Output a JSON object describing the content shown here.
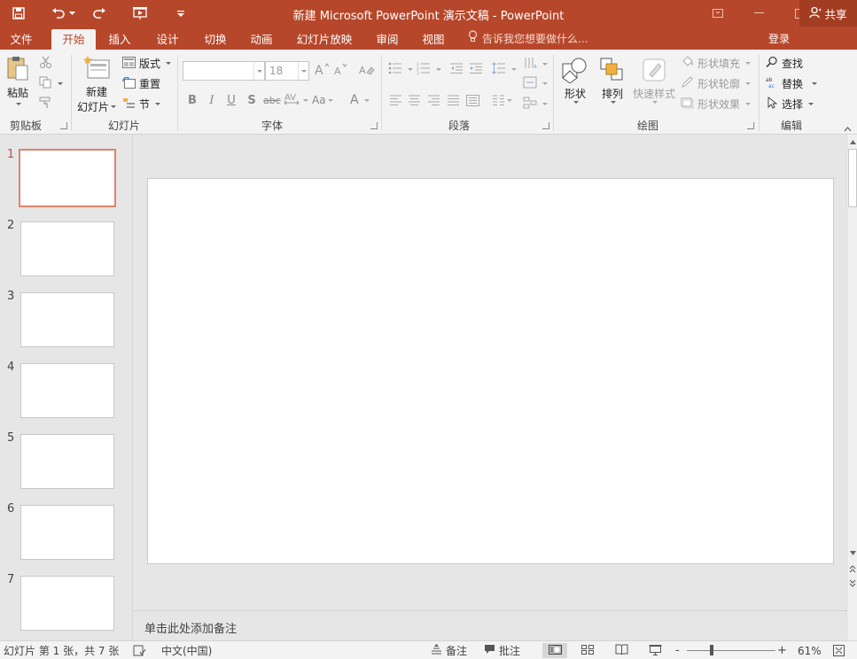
{
  "app": {
    "title": "新建 Microsoft PowerPoint 演示文稿 - PowerPoint",
    "accent": "#b7472a"
  },
  "tabs": [
    {
      "label": "文件"
    },
    {
      "label": "开始"
    },
    {
      "label": "插入"
    },
    {
      "label": "设计"
    },
    {
      "label": "切换"
    },
    {
      "label": "动画"
    },
    {
      "label": "幻灯片放映"
    },
    {
      "label": "审阅"
    },
    {
      "label": "视图"
    }
  ],
  "tellme": "告诉我您想要做什么...",
  "account": {
    "login": "登录",
    "share": "共享"
  },
  "ribbon": {
    "clipboard": {
      "label": "剪贴板",
      "paste": "粘贴"
    },
    "slides": {
      "label": "幻灯片",
      "new_slide_line1": "新建",
      "new_slide_line2": "幻灯片",
      "layout": "版式",
      "reset": "重置",
      "section": "节"
    },
    "font": {
      "label": "字体",
      "font_name": "",
      "font_size": "18"
    },
    "paragraph": {
      "label": "段落"
    },
    "drawing": {
      "label": "绘图",
      "shapes": "形状",
      "arrange": "排列",
      "quick_styles": "快速样式",
      "shape_fill": "形状填充",
      "shape_outline": "形状轮廓",
      "shape_effects": "形状效果"
    },
    "editing": {
      "label": "编辑",
      "find": "查找",
      "replace": "替换",
      "select": "选择"
    }
  },
  "slides": [
    {
      "num": "1",
      "active": true
    },
    {
      "num": "2"
    },
    {
      "num": "3"
    },
    {
      "num": "4"
    },
    {
      "num": "5"
    },
    {
      "num": "6"
    },
    {
      "num": "7"
    }
  ],
  "notes_placeholder": "单击此处添加备注",
  "status": {
    "slide_info": "幻灯片 第 1 张，共 7 张",
    "language": "中文(中国)",
    "notes": "备注",
    "comments": "批注",
    "zoom": "61%",
    "zoom_minus": "-",
    "zoom_plus": "+"
  }
}
